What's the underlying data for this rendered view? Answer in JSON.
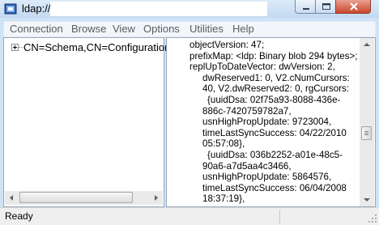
{
  "window": {
    "title": "ldap://"
  },
  "menu": [
    "Connection",
    "Browse",
    "View",
    "Options",
    "Utilities",
    "Help"
  ],
  "tree": {
    "items": [
      {
        "label": "CN=Schema,CN=Configuration"
      }
    ]
  },
  "output": {
    "lines": [
      "objectVersion: 47;",
      "prefixMap: <ldp: Binary blob 294 bytes>;",
      "replUpToDateVector: dwVersion: 2,",
      "dwReserved1: 0, V2.cNumCursors:",
      "40, V2.dwReserved2: 0, rgCursors:",
      "{uuidDsa: 02f75a93-8088-436e-",
      "886c-7420759782a7,",
      "usnHighPropUpdate: 9723004,",
      "timeLastSyncSuccess: 04/22/2010",
      "05:57:08},",
      "{uuidDsa: 036b2252-a01e-48c5-",
      "90a6-a7d5aa4c3466,",
      "usnHighPropUpdate: 5864576,",
      "timeLastSyncSuccess: 06/04/2008",
      "18:37:19},"
    ]
  },
  "status": {
    "text": "Ready"
  },
  "icons": {
    "app": "app-icon",
    "minimize": "minimize-icon",
    "maximize": "maximize-icon",
    "close": "close-icon"
  }
}
